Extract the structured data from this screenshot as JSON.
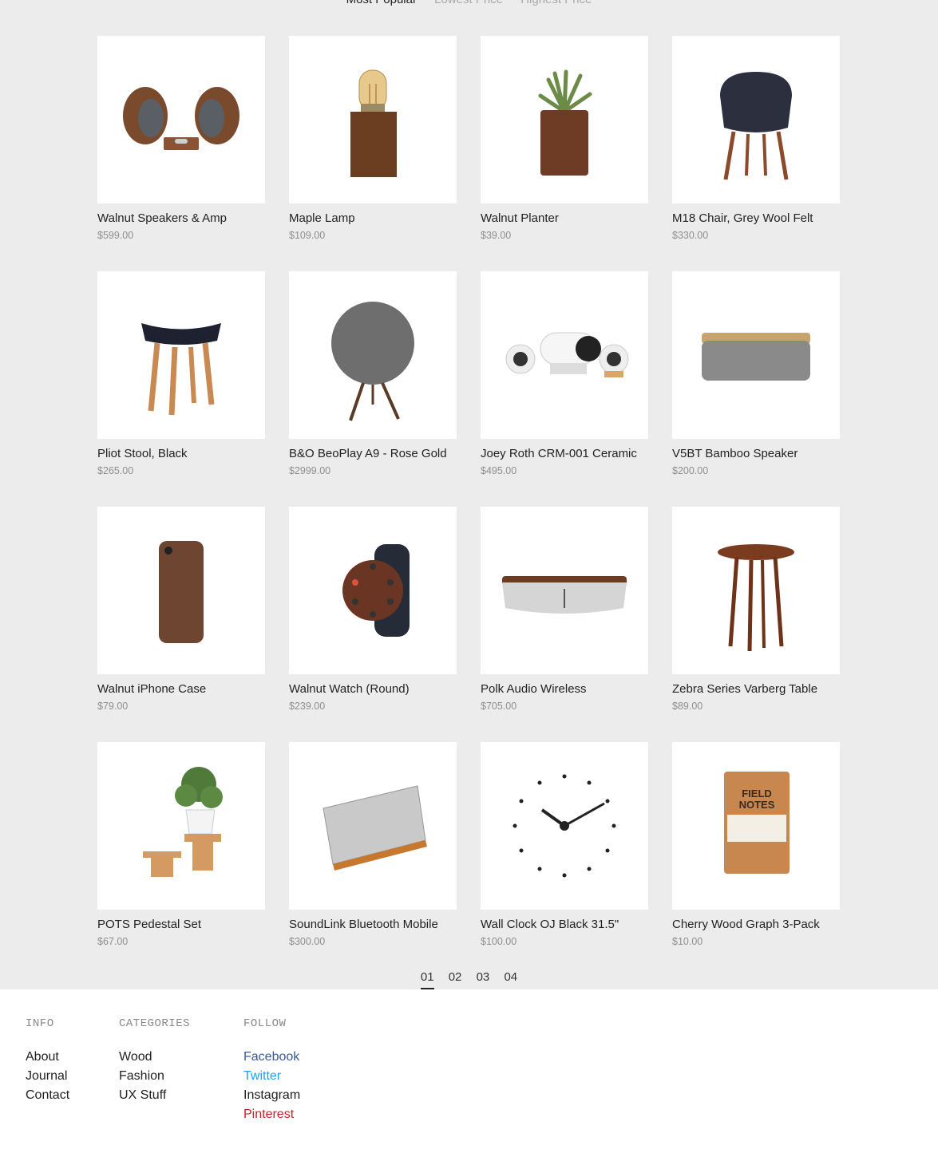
{
  "sort": [
    "Most Popular",
    "Lowest Price",
    "Highest Price"
  ],
  "products": [
    {
      "name": "Walnut Speakers & Amp",
      "price": "$599.00",
      "icon": "speakers-icon"
    },
    {
      "name": "Maple Lamp",
      "price": "$109.00",
      "icon": "lamp-icon"
    },
    {
      "name": "Walnut Planter",
      "price": "$39.00",
      "icon": "planter-icon"
    },
    {
      "name": "M18 Chair, Grey Wool Felt",
      "price": "$330.00",
      "icon": "chair-icon"
    },
    {
      "name": "Pliot Stool, Black",
      "price": "$265.00",
      "icon": "stool-icon"
    },
    {
      "name": "B&O BeoPlay A9 - Rose Gold",
      "price": "$2999.00",
      "icon": "round-speaker-icon"
    },
    {
      "name": "Joey Roth CRM-001 Ceramic",
      "price": "$495.00",
      "icon": "ceramic-speakers-icon"
    },
    {
      "name": "V5BT Bamboo Speaker",
      "price": "$200.00",
      "icon": "bamboo-speaker-icon"
    },
    {
      "name": "Walnut iPhone Case",
      "price": "$79.00",
      "icon": "phone-case-icon"
    },
    {
      "name": "Walnut Watch (Round)",
      "price": "$239.00",
      "icon": "watch-icon"
    },
    {
      "name": "Polk Audio Wireless",
      "price": "$705.00",
      "icon": "wireless-speaker-icon"
    },
    {
      "name": "Zebra Series Varberg Table",
      "price": "$89.00",
      "icon": "side-table-icon"
    },
    {
      "name": "POTS Pedestal Set",
      "price": "$67.00",
      "icon": "pedestal-plant-icon"
    },
    {
      "name": "SoundLink Bluetooth Mobile",
      "price": "$300.00",
      "icon": "bluetooth-speaker-icon"
    },
    {
      "name": "Wall Clock OJ Black 31.5\"",
      "price": "$100.00",
      "icon": "wall-clock-icon"
    },
    {
      "name": "Cherry Wood Graph 3-Pack",
      "price": "$10.00",
      "icon": "notebook-icon"
    }
  ],
  "pagination": [
    "01",
    "02",
    "03",
    "04"
  ],
  "footer": {
    "info": {
      "title": "INFO",
      "links": [
        "About",
        "Journal",
        "Contact"
      ]
    },
    "categories": {
      "title": "CATEGORIES",
      "links": [
        "Wood",
        "Fashion",
        "UX Stuff"
      ]
    },
    "follow": {
      "title": "FOLLOW",
      "links": [
        "Facebook",
        "Twitter",
        "Instagram",
        "Pinterest"
      ]
    },
    "follow_colors": [
      "#3b5998",
      "#1da1f2",
      "#222222",
      "#cb2027"
    ],
    "notebook_text": [
      "FIELD",
      "NOTES"
    ]
  }
}
